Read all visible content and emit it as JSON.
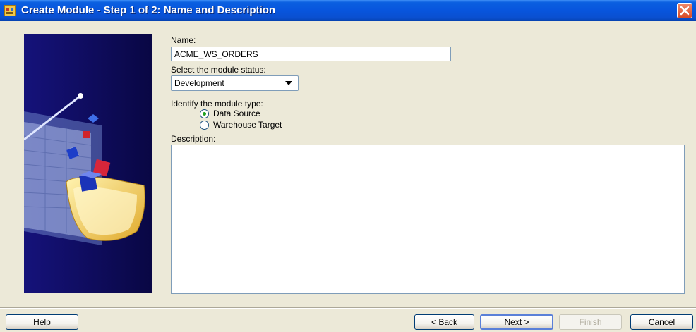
{
  "window": {
    "title": "Create Module - Step 1 of 2: Name and Description",
    "icon": "app-icon"
  },
  "form": {
    "name_label": "Name:",
    "name_value": "ACME_WS_ORDERS",
    "status_label": "Select the module status:",
    "status_value": "Development",
    "type_label": "Identify the module type:",
    "type_options": [
      {
        "label": "Data Source",
        "checked": true
      },
      {
        "label": "Warehouse Target",
        "checked": false
      }
    ],
    "description_label": "Description:",
    "description_value": ""
  },
  "buttons": {
    "help": "Help",
    "back": "< Back",
    "next": "Next >",
    "finish": "Finish",
    "cancel": "Cancel"
  }
}
